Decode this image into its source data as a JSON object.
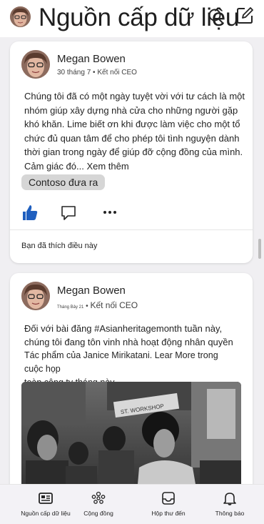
{
  "header": {
    "title": "Nguồn cấp dữ liệu"
  },
  "posts": [
    {
      "author": "Megan Bowen",
      "date": "30 tháng 7",
      "separator": "•",
      "community": "Kết nối CEO",
      "body": "Chúng tôi đã có một ngày tuyệt vời với tư cách là một nhóm giúp xây dựng nhà cửa cho những người gặp khó khăn. Lime biết ơn khi được làm việc cho một tổ chức đủ quan tâm để cho phép tôi tình nguyện dành thời gian trong ngày để giúp đỡ cộng đồng của mình. Cảm giác đó...",
      "see_more": "Xem thêm",
      "tag": "Contoso đưa ra",
      "liked_text": "Bạn đã thích điều này"
    },
    {
      "author": "Megan Bowen",
      "date": "Tháng Bảy 21",
      "separator": "•",
      "community": "Kết nối CEO",
      "lines": [
        "Đối với bài đăng #Asianheritagemonth tuần này,",
        "chúng tôi đang tôn vinh nhà hoạt động nhân quyền",
        "Tác phẩm của Janice Mirikatani. Lear More trong cuộc họp",
        "toàn công ty tháng này"
      ],
      "photo_sign": "ST. WORKSHOP"
    }
  ],
  "tabs": [
    {
      "label": "Nguồn cấp dữ liệu",
      "icon": "feed-icon",
      "active": true
    },
    {
      "label": "Cộng đồng",
      "icon": "community-icon",
      "active": false
    },
    {
      "label": "Hộp thư đến",
      "icon": "inbox-icon",
      "active": false
    },
    {
      "label": "Thông báo",
      "icon": "bell-icon",
      "active": false
    }
  ],
  "colors": {
    "like_blue": "#1f5fbf",
    "background": "#f0eff2",
    "tag_bg": "#d6d6d6"
  }
}
